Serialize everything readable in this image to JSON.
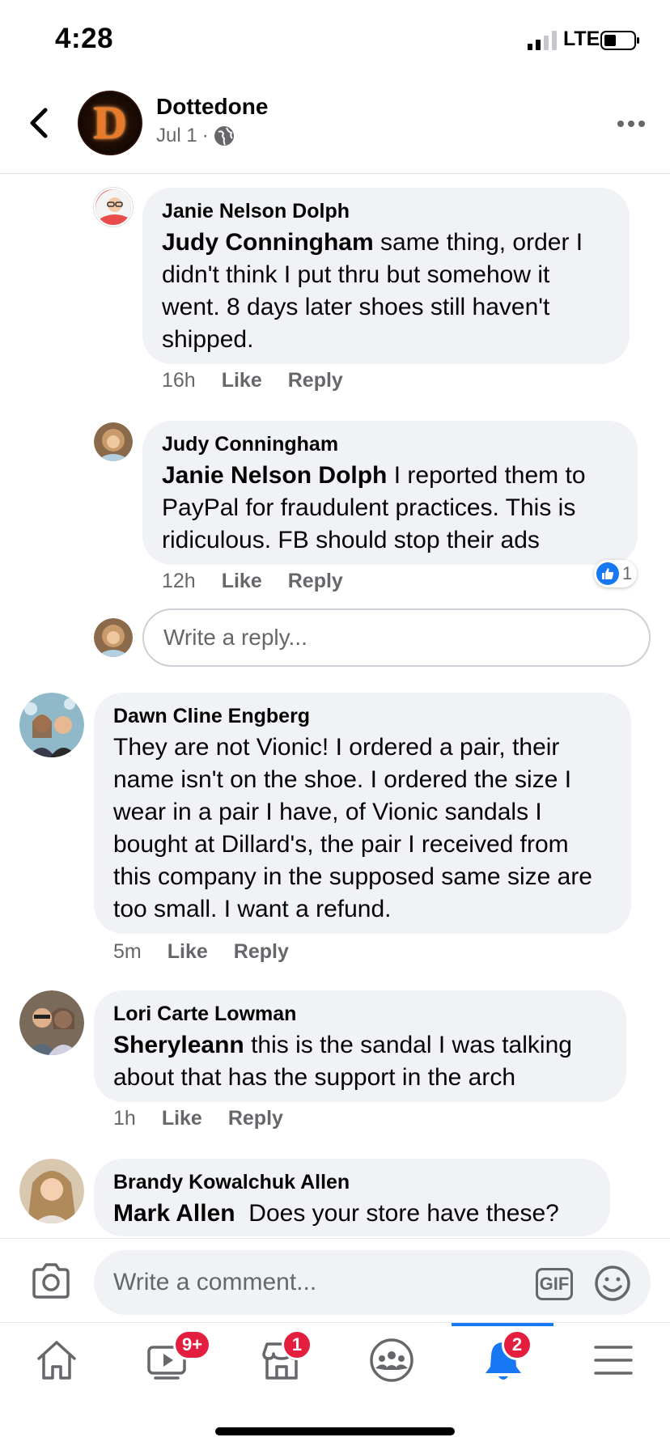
{
  "status_bar": {
    "time": "4:28",
    "network": "LTE"
  },
  "post": {
    "page_name": "Dottedone",
    "date": "Jul 1",
    "separator": "·",
    "avatar_letter": "D"
  },
  "comments": [
    {
      "author": "Janie Nelson Dolph",
      "mention": "Judy Conningham",
      "text": " same thing, order I didn't think I put thru but somehow it went.  8 days later shoes still haven't shipped.",
      "time": "16h",
      "like": "Like",
      "reply": "Reply"
    },
    {
      "author": "Judy Conningham",
      "mention": "Janie Nelson Dolph",
      "text": " I reported them to PayPal for fraudulent practices.  This is ridiculous.  FB should stop their ads",
      "time": "12h",
      "like": "Like",
      "reply": "Reply",
      "reaction_count": "1"
    },
    {
      "author": "Dawn Cline Engberg",
      "mention": "",
      "text": "They are not Vionic! I ordered a pair, their name isn't on the shoe. I ordered the size I wear in a pair I have, of Vionic sandals I bought at Dillard's, the pair I received from this company in the supposed same size are too small. I want a refund.",
      "time": "5m",
      "like": "Like",
      "reply": "Reply"
    },
    {
      "author": "Lori Carte Lowman",
      "mention": "Sheryleann",
      "text": " this is the sandal I was talking about that has the support in the arch",
      "time": "1h",
      "like": "Like",
      "reply": "Reply"
    },
    {
      "author": "Brandy Kowalchuk Allen",
      "mention": "Mark Allen",
      "text": "  Does your store have these?"
    }
  ],
  "reply_input": {
    "placeholder": "Write a reply..."
  },
  "comment_bar": {
    "placeholder": "Write a comment...",
    "gif_label": "GIF"
  },
  "tabs": [
    {
      "icon": "home-icon"
    },
    {
      "icon": "watch-icon",
      "badge": "9+"
    },
    {
      "icon": "marketplace-icon",
      "badge": "1"
    },
    {
      "icon": "groups-icon"
    },
    {
      "icon": "notifications-icon",
      "badge": "2",
      "active": true
    },
    {
      "icon": "menu-icon"
    }
  ],
  "colors": {
    "accent": "#1877f2",
    "badge": "#e41e3f",
    "bubble": "#f0f2f5",
    "secondary_text": "#65676b"
  }
}
